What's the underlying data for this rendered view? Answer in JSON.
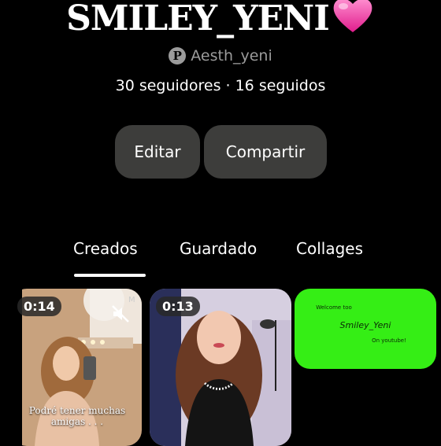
{
  "profile": {
    "name": "SMILEY_YENI",
    "username": "Aesth_yeni",
    "stats": "30 seguidores · 16 seguidos"
  },
  "buttons": {
    "edit": "Editar",
    "share": "Compartir"
  },
  "tabs": [
    {
      "label": "Creados",
      "active": true
    },
    {
      "label": "Guardado",
      "active": false
    },
    {
      "label": "Collages",
      "active": false
    }
  ],
  "pins": [
    {
      "duration": "0:14",
      "caption": "Podré tener muchas amigas . . ."
    },
    {
      "duration": "0:13"
    },
    {
      "lines": [
        "Welcome too",
        "Smiley_Yeni",
        "On youtube!"
      ]
    }
  ],
  "colors": {
    "background": "#000000",
    "button": "#3d3d3b",
    "green_screen": "#35ee15",
    "heart": "#ff3fa4"
  }
}
